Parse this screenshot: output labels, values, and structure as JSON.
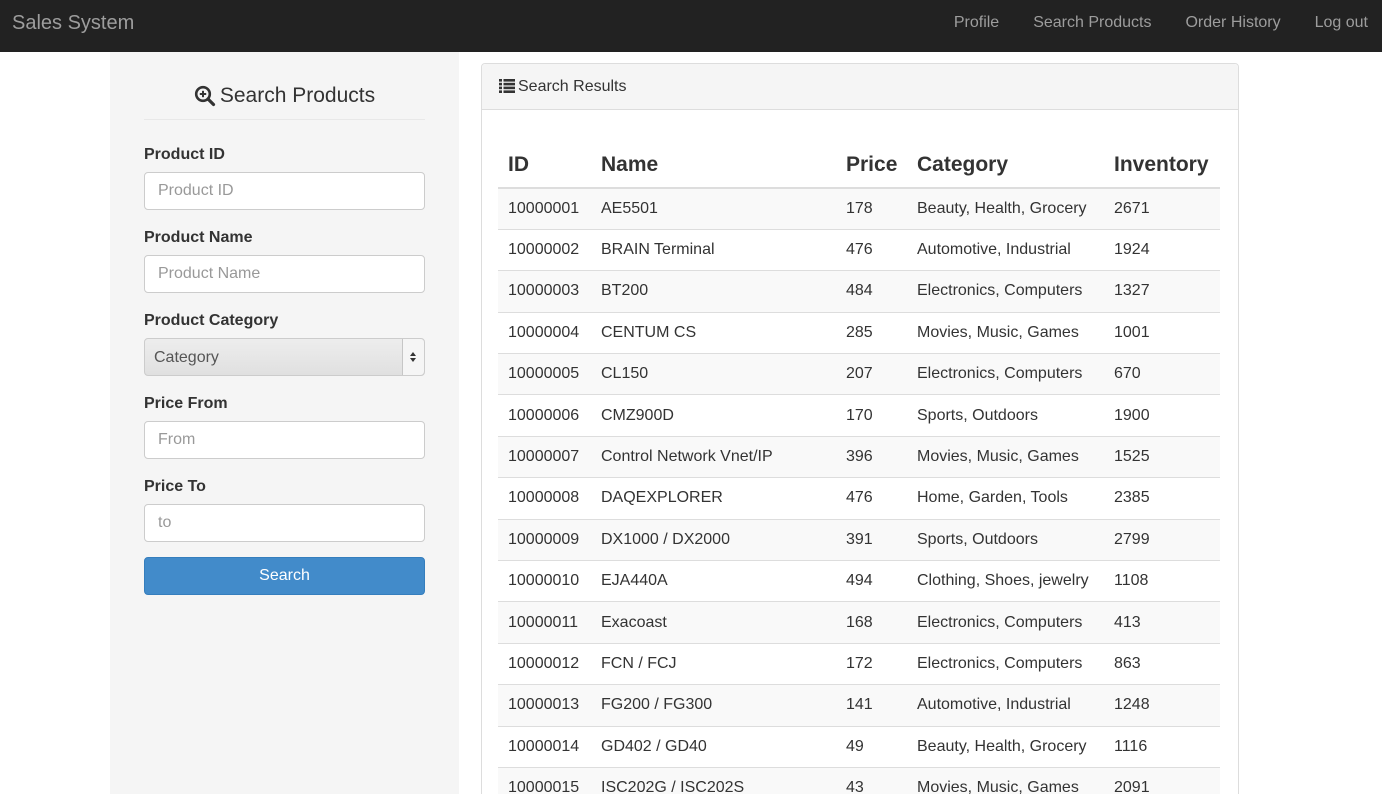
{
  "navbar": {
    "brand": "Sales System",
    "links": [
      "Profile",
      "Search Products",
      "Order History",
      "Log out"
    ]
  },
  "sidebar": {
    "title": "Search Products",
    "fields": {
      "product_id": {
        "label": "Product ID",
        "placeholder": "Product ID"
      },
      "product_name": {
        "label": "Product Name",
        "placeholder": "Product Name"
      },
      "product_category": {
        "label": "Product Category",
        "selected": "Category"
      },
      "price_from": {
        "label": "Price From",
        "placeholder": "From"
      },
      "price_to": {
        "label": "Price To",
        "placeholder": "to"
      }
    },
    "search_button": "Search"
  },
  "results": {
    "title": "Search Results",
    "columns": [
      "ID",
      "Name",
      "Price",
      "Category",
      "Inventory"
    ],
    "rows": [
      [
        "10000001",
        "AE5501",
        "178",
        "Beauty, Health, Grocery",
        "2671"
      ],
      [
        "10000002",
        "BRAIN Terminal",
        "476",
        "Automotive, Industrial",
        "1924"
      ],
      [
        "10000003",
        "BT200",
        "484",
        "Electronics, Computers",
        "1327"
      ],
      [
        "10000004",
        "CENTUM CS",
        "285",
        "Movies, Music, Games",
        "1001"
      ],
      [
        "10000005",
        "CL150",
        "207",
        "Electronics, Computers",
        "670"
      ],
      [
        "10000006",
        "CMZ900D",
        "170",
        "Sports, Outdoors",
        "1900"
      ],
      [
        "10000007",
        "Control Network Vnet/IP",
        "396",
        "Movies, Music, Games",
        "1525"
      ],
      [
        "10000008",
        "DAQEXPLORER",
        "476",
        "Home, Garden, Tools",
        "2385"
      ],
      [
        "10000009",
        "DX1000 / DX2000",
        "391",
        "Sports, Outdoors",
        "2799"
      ],
      [
        "10000010",
        "EJA440A",
        "494",
        "Clothing, Shoes, jewelry",
        "1108"
      ],
      [
        "10000011",
        "Exacoast",
        "168",
        "Electronics, Computers",
        "413"
      ],
      [
        "10000012",
        "FCN / FCJ",
        "172",
        "Electronics, Computers",
        "863"
      ],
      [
        "10000013",
        "FG200 / FG300",
        "141",
        "Automotive, Industrial",
        "1248"
      ],
      [
        "10000014",
        "GD402 / GD40",
        "49",
        "Beauty, Health, Grocery",
        "1116"
      ],
      [
        "10000015",
        "ISC202G / ISC202S",
        "43",
        "Movies, Music, Games",
        "2091"
      ]
    ]
  },
  "colors": {
    "navbar_bg": "#222222",
    "navbar_text": "#9d9d9d",
    "sidebar_bg": "#f5f5f5",
    "primary_button": "#428bca"
  }
}
